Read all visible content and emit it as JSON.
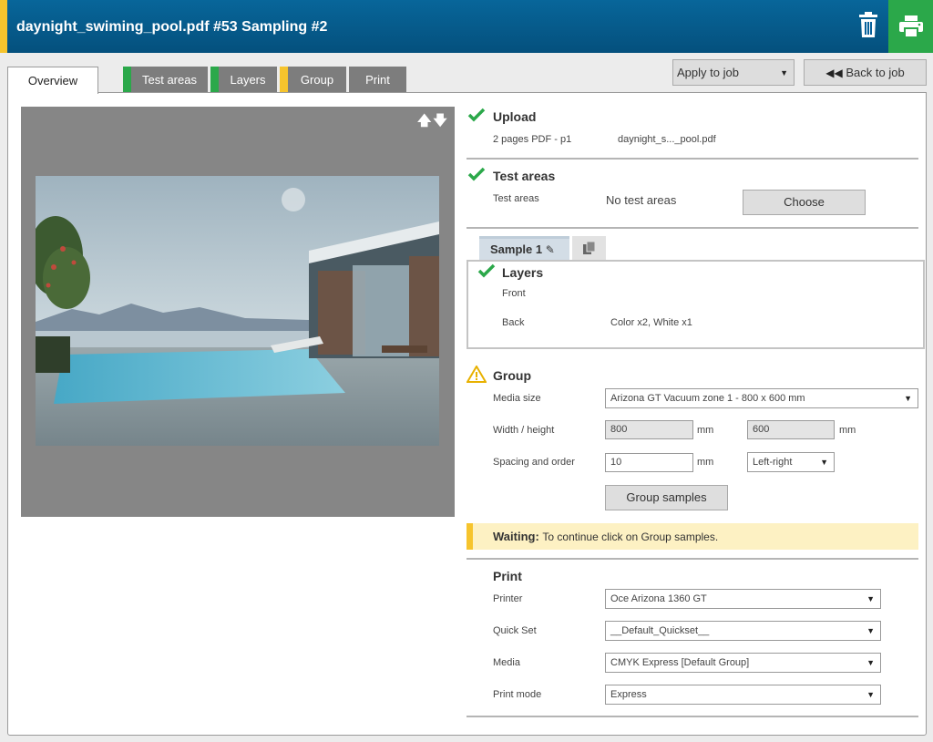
{
  "header": {
    "title": "daynight_swiming_pool.pdf #53 Sampling #2",
    "delete_icon": "trash-icon",
    "print_icon": "printer-icon",
    "colors": {
      "bar": "#04507d",
      "accent": "#f6c42d",
      "print": "#2ba84a"
    }
  },
  "tabs": [
    {
      "label": "Overview",
      "status": "active"
    },
    {
      "label": "Test areas",
      "status": "done",
      "flag_color": "#2ba84a"
    },
    {
      "label": "Layers",
      "status": "done",
      "flag_color": "#2ba84a"
    },
    {
      "label": "Group",
      "status": "warning",
      "flag_color": "#f6c42d"
    },
    {
      "label": "Print",
      "status": "none"
    }
  ],
  "toolbar": {
    "apply_label": "Apply to job",
    "back_label": "Back to job",
    "back_icon": "rewind-icon"
  },
  "preview": {
    "move_icons": "move-up-down-icons"
  },
  "upload": {
    "title": "Upload",
    "pages": "2 pages PDF - p1",
    "file": "daynight_s..._pool.pdf"
  },
  "test_areas": {
    "title": "Test areas",
    "label": "Test areas",
    "value": "No test areas",
    "choose_label": "Choose"
  },
  "sample": {
    "tab_label": "Sample 1",
    "edit_icon": "edit-icon",
    "copy_icon": "copy-icon",
    "layers": {
      "title": "Layers",
      "front_label": "Front",
      "back_label": "Back",
      "back_value": "Color x2, White x1"
    }
  },
  "group": {
    "title": "Group",
    "status_icon": "warning-icon",
    "media_size_label": "Media size",
    "media_size_value": "Arizona GT Vacuum zone 1 - 800 x 600 mm",
    "wh_label": "Width / height",
    "width": "800",
    "height": "600",
    "unit": "mm",
    "spacing_label": "Spacing and order",
    "spacing": "10",
    "order": "Left-right",
    "group_button": "Group samples"
  },
  "waiting": {
    "strong": "Waiting:",
    "text": "To continue click on Group samples."
  },
  "print": {
    "title": "Print",
    "printer_label": "Printer",
    "printer_value": "Oce Arizona 1360 GT",
    "quickset_label": "Quick Set",
    "quickset_value": "__Default_Quickset__",
    "media_label": "Media",
    "media_value": "CMYK Express [Default Group]",
    "mode_label": "Print mode",
    "mode_value": "Express"
  }
}
